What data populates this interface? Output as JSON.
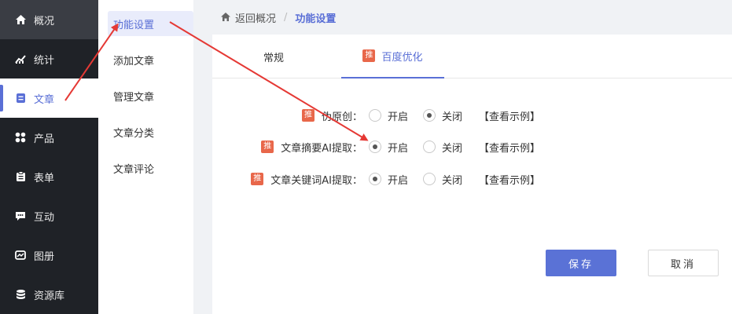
{
  "sidebar": {
    "items": [
      {
        "label": "概况",
        "icon": "home-icon"
      },
      {
        "label": "统计",
        "icon": "chart-icon"
      },
      {
        "label": "文章",
        "icon": "article-icon"
      },
      {
        "label": "产品",
        "icon": "grid-icon"
      },
      {
        "label": "表单",
        "icon": "clipboard-icon"
      },
      {
        "label": "互动",
        "icon": "chat-icon"
      },
      {
        "label": "图册",
        "icon": "image-icon"
      },
      {
        "label": "资源库",
        "icon": "database-icon"
      }
    ]
  },
  "submenu": {
    "items": [
      {
        "label": "功能设置"
      },
      {
        "label": "添加文章"
      },
      {
        "label": "管理文章"
      },
      {
        "label": "文章分类"
      },
      {
        "label": "文章评论"
      }
    ]
  },
  "breadcrumb": {
    "back": "返回概况",
    "separator": "/",
    "current": "功能设置"
  },
  "tabs": [
    {
      "label": "常规"
    },
    {
      "label": "百度优化",
      "badge": "推"
    }
  ],
  "settings": [
    {
      "badge": "推",
      "label": "伪原创：",
      "on_label": "开启",
      "off_label": "关闭",
      "selected": "off",
      "example": "【查看示例】"
    },
    {
      "badge": "推",
      "label": "文章摘要AI提取：",
      "on_label": "开启",
      "off_label": "关闭",
      "selected": "on",
      "example": "【查看示例】"
    },
    {
      "badge": "推",
      "label": "文章关键词AI提取：",
      "on_label": "开启",
      "off_label": "关闭",
      "selected": "on",
      "example": "【查看示例】"
    }
  ],
  "buttons": {
    "save": "保存",
    "cancel": "取消"
  },
  "colors": {
    "accent": "#5a6fd6",
    "badge": "#e8674a",
    "sidebar_bg": "#1f2227",
    "annotation_arrow": "#e53935"
  }
}
